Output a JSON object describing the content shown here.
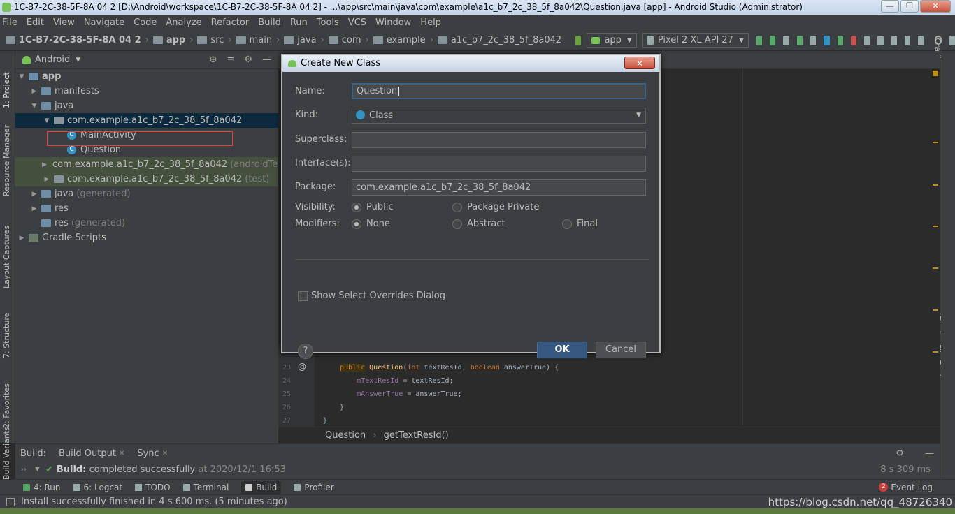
{
  "window": {
    "title": "1C-B7-2C-38-5F-8A 04 2 [D:\\Android\\workspace\\1C-B7-2C-38-5F-8A 04 2] - ...\\app\\src\\main\\java\\com\\example\\a1c_b7_2c_38_5f_8a042\\Question.java [app] - Android Studio (Administrator)"
  },
  "menu": [
    "File",
    "Edit",
    "View",
    "Navigate",
    "Code",
    "Analyze",
    "Refactor",
    "Build",
    "Run",
    "Tools",
    "VCS",
    "Window",
    "Help"
  ],
  "breadcrumbs": {
    "project": "1C-B7-2C-38-5F-8A 04 2",
    "items": [
      "app",
      "src",
      "main",
      "java",
      "com",
      "example",
      "a1c_b7_2c_38_5f_8a042"
    ]
  },
  "toolbar": {
    "run_config": "app",
    "device": "Pixel 2 XL API 27"
  },
  "side_tabs": {
    "left": [
      "1: Project",
      "Resource Manager",
      "Layout Captures",
      "7: Structure",
      "2: Favorites",
      "Build Variants"
    ],
    "right": [
      "Gradle",
      "Device File Explorer"
    ]
  },
  "project_panel": {
    "view": "Android",
    "tree": {
      "app": "app",
      "manifests": "manifests",
      "java": "java",
      "pkg_main": "com.example.a1c_b7_2c_38_5f_8a042",
      "main_activity": "MainActivity",
      "question": "Question",
      "pkg_android_test": "com.example.a1c_b7_2c_38_5f_8a042",
      "android_test_tag": "(androidTest)",
      "pkg_test": "com.example.a1c_b7_2c_38_5f_8a042",
      "test_tag": "(test)",
      "java_generated": "java",
      "generated_tag": "(generated)",
      "res": "res",
      "res_generated": "res",
      "res_generated_tag": "(generated)",
      "gradle_scripts": "Gradle Scripts"
    }
  },
  "editor": {
    "lines": [
      {
        "num": "23",
        "kw1": "public",
        "name": "Question",
        "rest1": "(",
        "kw2": "int",
        "rest2": " textResId, ",
        "kw3": "boolean",
        "rest3": " answerTrue) {"
      },
      {
        "num": "24",
        "field": "mTextResId",
        "rest": " = textResId;"
      },
      {
        "num": "25",
        "field": "mAnswerTrue",
        "rest": " = answerTrue;"
      },
      {
        "num": "26",
        "rest": "}"
      },
      {
        "num": "27",
        "rest": "}"
      }
    ],
    "breadcrumb_class": "Question",
    "breadcrumb_method": "getTextResId()"
  },
  "dialog": {
    "title": "Create New Class",
    "name_label": "Name:",
    "name_value": "Question",
    "kind_label": "Kind:",
    "kind_value": "Class",
    "superclass_label": "Superclass:",
    "superclass_value": "",
    "interfaces_label": "Interface(s):",
    "interfaces_value": "",
    "package_label": "Package:",
    "package_value": "com.example.a1c_b7_2c_38_5f_8a042",
    "visibility_label": "Visibility:",
    "visibility_options": [
      "Public",
      "Package Private"
    ],
    "modifiers_label": "Modifiers:",
    "modifier_options": [
      "None",
      "Abstract",
      "Final"
    ],
    "overrides_label": "Show Select Overrides Dialog",
    "help_label": "?",
    "ok_label": "OK",
    "cancel_label": "Cancel"
  },
  "build_panel": {
    "label": "Build:",
    "tabs": [
      "Build Output",
      "Sync"
    ],
    "result_prefix": "Build:",
    "result_text": "completed successfully",
    "result_time": "at 2020/12/1 16:53",
    "duration": "8 s 309 ms"
  },
  "tool_windows": [
    "4: Run",
    "6: Logcat",
    "TODO",
    "Terminal",
    "Build",
    "Profiler"
  ],
  "event_log": {
    "count": "2",
    "label": "Event Log"
  },
  "status": {
    "message": "Install successfully finished in 4 s 600 ms. (5 minutes ago)",
    "watermark": "https://blog.csdn.net/qq_48726340"
  }
}
